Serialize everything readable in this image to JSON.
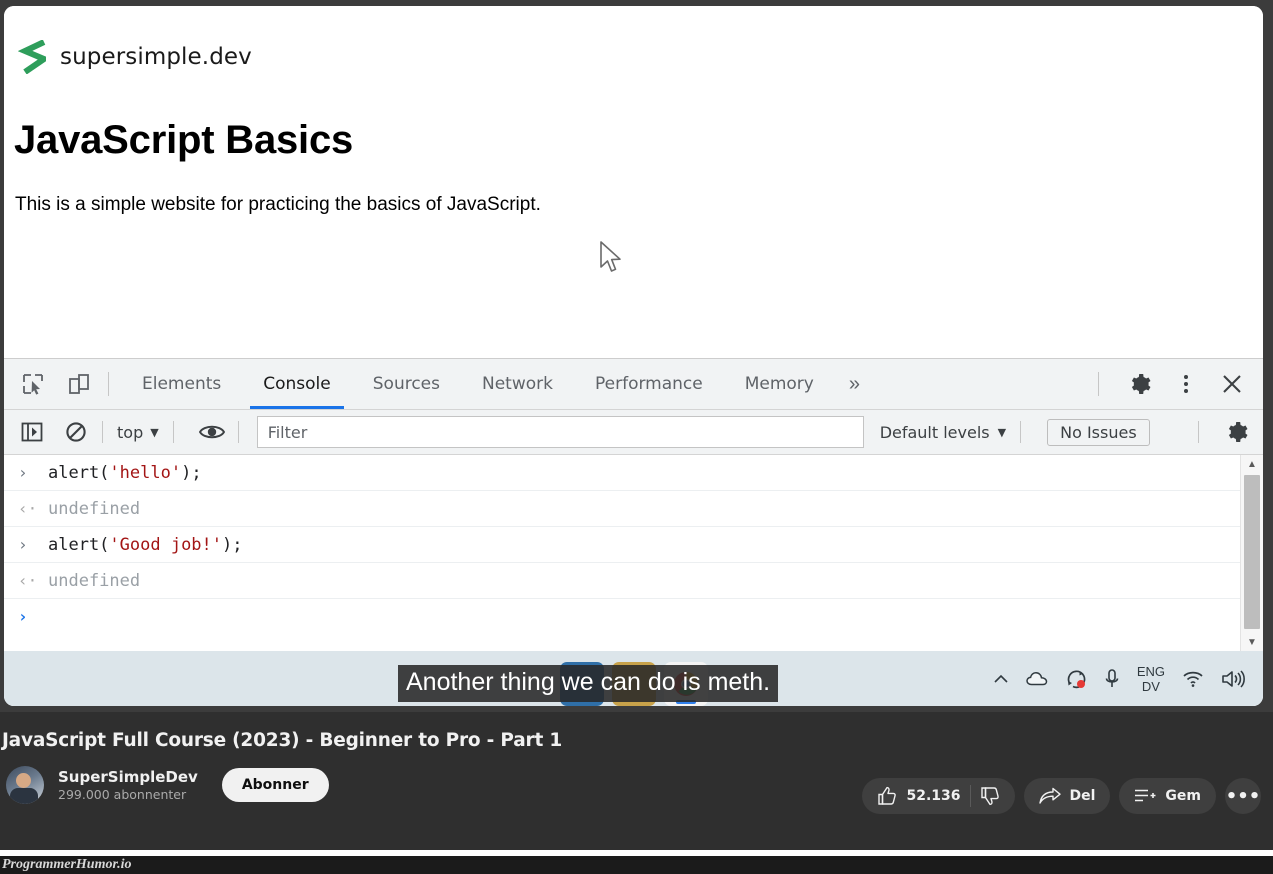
{
  "webpage": {
    "logo_text": "supersimple.dev",
    "logo_icon": "supersimple-s-logo",
    "heading": "JavaScript Basics",
    "paragraph": "This is a simple website for practicing the basics of JavaScript."
  },
  "devtools": {
    "toolbar_icons": {
      "inspect": "inspect-element-icon",
      "device": "device-toolbar-icon",
      "settings": "gear-icon",
      "more": "kebab-menu-icon",
      "close": "close-icon"
    },
    "tabs": [
      {
        "label": "Elements",
        "active": false
      },
      {
        "label": "Console",
        "active": true
      },
      {
        "label": "Sources",
        "active": false
      },
      {
        "label": "Network",
        "active": false
      },
      {
        "label": "Performance",
        "active": false
      },
      {
        "label": "Memory",
        "active": false
      }
    ],
    "more_tabs_label": "»",
    "console_toolbar": {
      "sidebar_toggle_icon": "console-sidebar-icon",
      "clear_icon": "clear-console-icon",
      "context_label": "top",
      "context_caret": "▼",
      "eye_icon": "live-expression-eye-icon",
      "filter_placeholder": "Filter",
      "levels_label": "Default levels",
      "levels_caret": "▼",
      "issues_label": "No Issues",
      "settings_icon": "gear-icon"
    },
    "console_lines": [
      {
        "kind": "input",
        "gutter": "›",
        "code_prefix": "alert(",
        "code_string": "'hello'",
        "code_suffix": ");"
      },
      {
        "kind": "output",
        "gutter": "‹·",
        "text": "undefined"
      },
      {
        "kind": "input",
        "gutter": "›",
        "code_prefix": "alert(",
        "code_string": "'Good job!'",
        "code_suffix": ");"
      },
      {
        "kind": "output",
        "gutter": "‹·",
        "text": "undefined"
      },
      {
        "kind": "prompt",
        "gutter": "›",
        "text": ""
      }
    ],
    "scrollbar": {
      "up_arrow": "▲",
      "down_arrow": "▼"
    }
  },
  "taskbar": {
    "tray": {
      "overflow_icon": "chevron-up-icon",
      "onedrive_icon": "cloud-icon",
      "recording_icon": "screen-recording-icon",
      "microphone_icon": "microphone-icon",
      "language_line1": "ENG",
      "language_line2": "DV",
      "wifi_icon": "wifi-icon",
      "volume_icon": "volume-icon"
    },
    "pinned_apps": [
      "app-blue",
      "app-yellow",
      "chrome"
    ]
  },
  "caption": {
    "text": "Another thing we can do is meth."
  },
  "youtube": {
    "video_title": "JavaScript Full Course (2023) - Beginner to Pro - Part 1",
    "channel_name": "SuperSimpleDev",
    "subscriber_count": "299.000 abonnenter",
    "subscribe_label": "Abonner",
    "actions": {
      "like_count": "52.136",
      "like_icon": "thumbs-up-icon",
      "dislike_icon": "thumbs-down-icon",
      "share_label": "Del",
      "share_icon": "share-arrow-icon",
      "save_label": "Gem",
      "save_icon": "save-to-playlist-icon",
      "more_label": "•••"
    }
  },
  "watermark": {
    "text": "ProgrammerHumor.io"
  },
  "colors": {
    "accent_blue": "#1a73e8",
    "devtools_toolbar": "#f1f3f4",
    "string_token": "#a31515",
    "taskbar": "#dce5ea",
    "youtube_bar": "#2f2f2f"
  }
}
